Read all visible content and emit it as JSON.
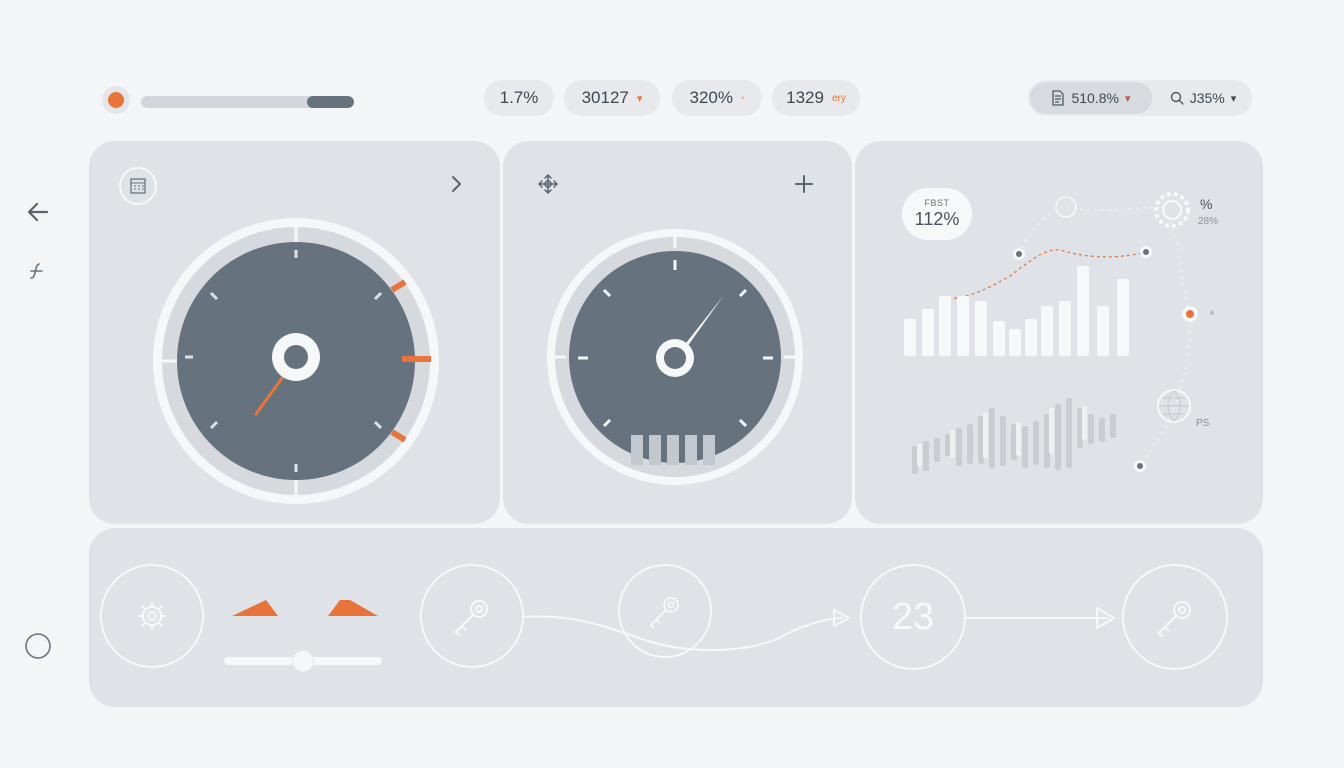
{
  "header": {
    "progress": {
      "fraction": 0.78
    },
    "stats": [
      {
        "value": "1.7%"
      },
      {
        "value": "30127",
        "caret": "▾"
      },
      {
        "value": "320%",
        "suffix": "◦"
      },
      {
        "value": "1329",
        "suffix": "ery"
      }
    ],
    "controls": {
      "left_value": "510.8%",
      "left_caret": "▾",
      "right_value": "J35%",
      "right_caret": "▾"
    }
  },
  "analytics": {
    "badge": {
      "label": "FBST",
      "value": "112%"
    },
    "top_right_label": "%",
    "top_right_sub": "28%",
    "marker_label": "ᵃ",
    "globe_label": "PS"
  },
  "workflow": {
    "step_number": "23",
    "slider": {
      "fraction": 0.5
    }
  },
  "colors": {
    "accent": "#e8743b",
    "dial": "#66727e",
    "panel": "#dfe2e6",
    "background": "#f4f5f7"
  }
}
